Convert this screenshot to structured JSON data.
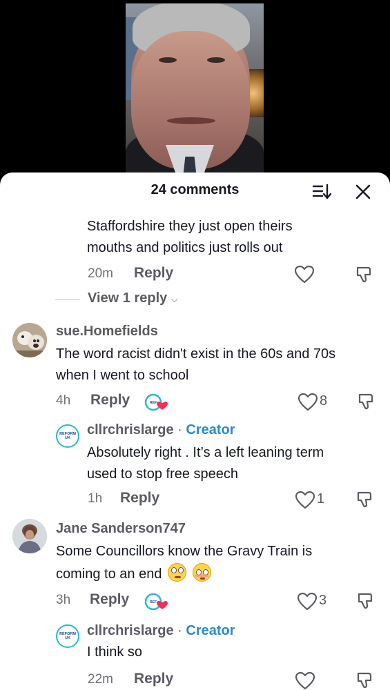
{
  "sheet": {
    "title": "24 comments",
    "icons": {
      "sort": "sort-icon",
      "close": "close-icon"
    }
  },
  "comments": [
    {
      "text_lines": [
        "Staffordshire they just open theirs",
        "mouths and politics just rolls out"
      ],
      "time": "20m",
      "reply_label": "Reply",
      "view_replies": "View 1 reply"
    },
    {
      "username": "sue.Homefields",
      "text_lines": [
        "The word racist didn't exist in the 60s and 70s",
        "when I went to school"
      ],
      "time": "4h",
      "reply_label": "Reply",
      "likes": "8",
      "reply": {
        "username": "cllrchrislarge",
        "badge": "Creator",
        "avatar_text": "REFORM UK",
        "text_lines": [
          "Absolutely right . It’s a left leaning term",
          "used to stop free speech"
        ],
        "time": "1h",
        "reply_label": "Reply",
        "likes": "1"
      }
    },
    {
      "username": "Jane Sanderson747",
      "text_lines": [
        "Some Councillors know the Gravy Train is",
        "coming to an end"
      ],
      "time": "3h",
      "reply_label": "Reply",
      "likes": "3",
      "reply": {
        "username": "cllrchrislarge",
        "badge": "Creator",
        "avatar_text": "REFORM UK",
        "text_lines": [
          "I think so"
        ],
        "time": "22m",
        "reply_label": "Reply"
      }
    }
  ],
  "colors": {
    "creator": "#2a89c9",
    "reform_ring": "#27b8d0",
    "text": "#161823",
    "muted": "#5a5b63"
  }
}
